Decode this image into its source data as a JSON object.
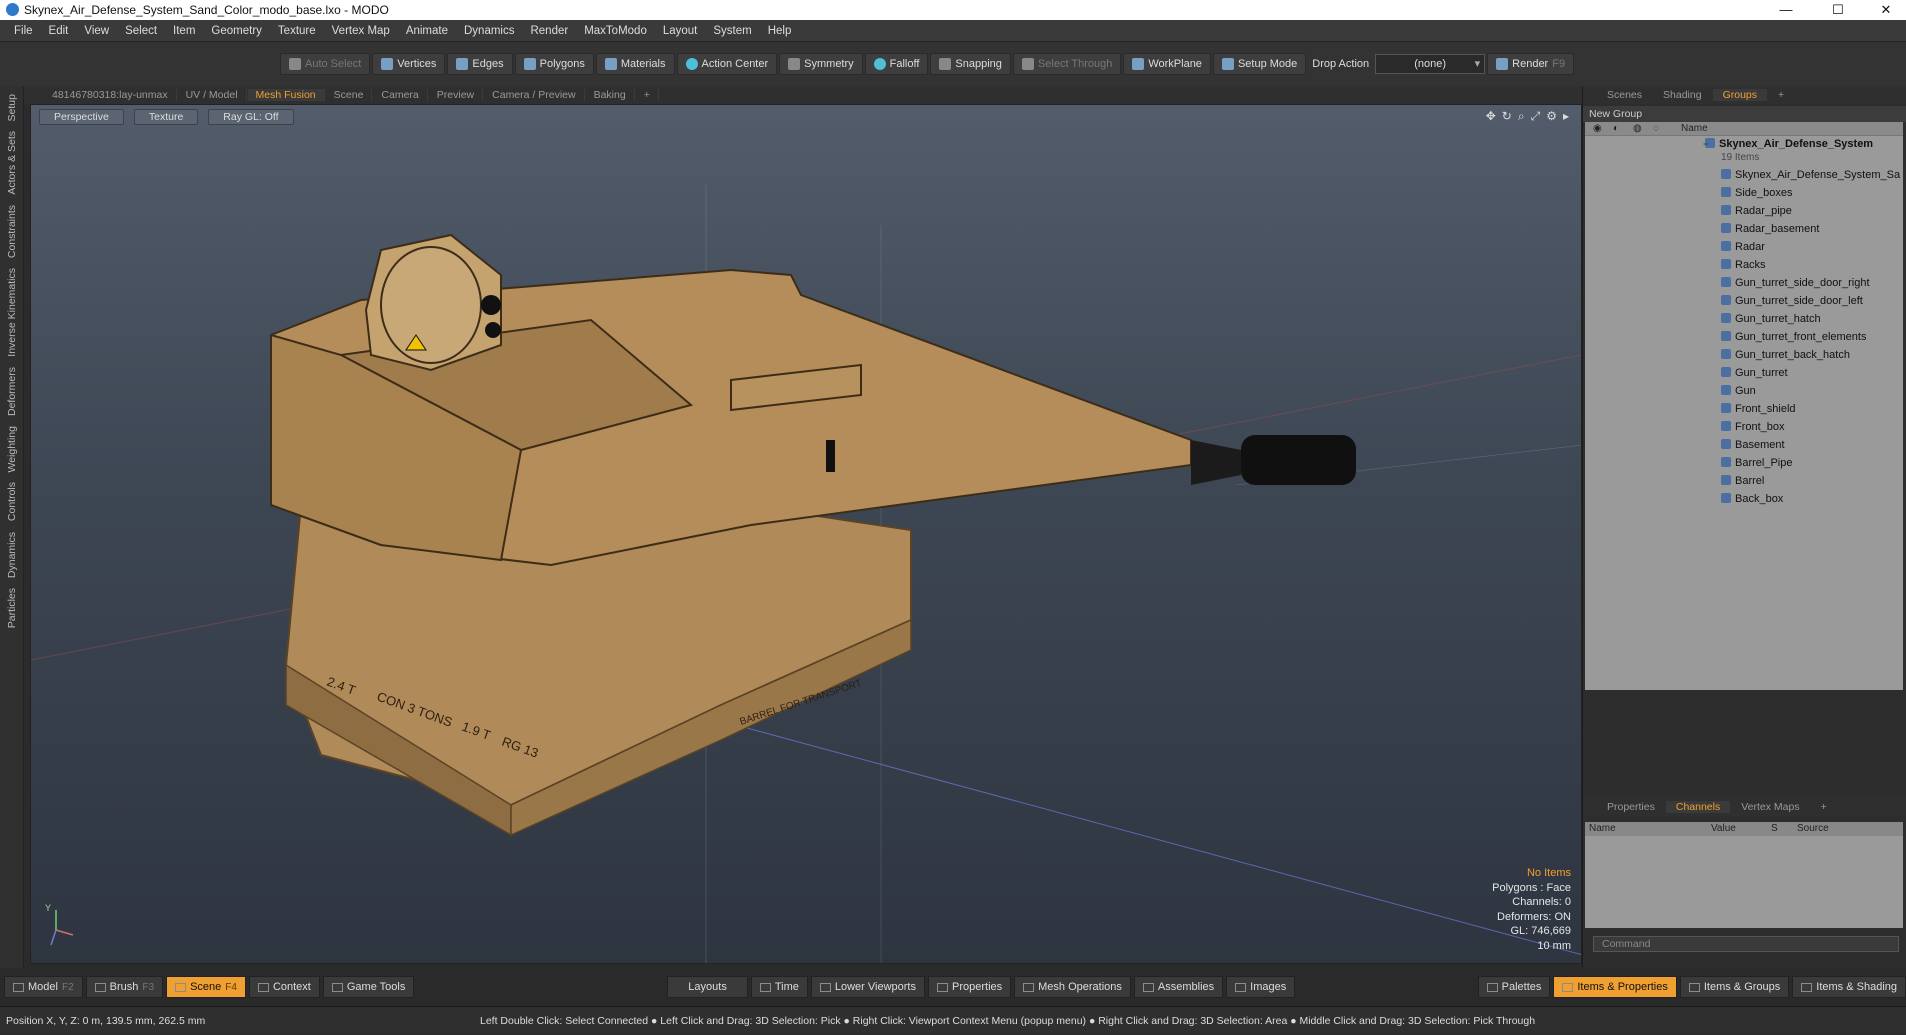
{
  "window": {
    "title": "Skynex_Air_Defense_System_Sand_Color_modo_base.lxo - MODO",
    "min": "—",
    "max": "☐",
    "close": "✕"
  },
  "menu": [
    "File",
    "Edit",
    "View",
    "Select",
    "Item",
    "Geometry",
    "Texture",
    "Vertex Map",
    "Animate",
    "Dynamics",
    "Render",
    "MaxToModo",
    "Layout",
    "System",
    "Help"
  ],
  "toolbar": {
    "auto_select": "Auto Select",
    "vertices": "Vertices",
    "edges": "Edges",
    "polygons": "Polygons",
    "materials": "Materials",
    "action_center": "Action Center",
    "symmetry": "Symmetry",
    "falloff": "Falloff",
    "snapping": "Snapping",
    "select_through": "Select Through",
    "workplane": "WorkPlane",
    "setup_mode": "Setup Mode",
    "drop_action_label": "Drop Action",
    "drop_action_value": "(none)",
    "render": "Render",
    "render_key": "F9"
  },
  "left_tabs": [
    "Setup",
    "Actors & Sets",
    "Constraints",
    "Inverse Kinematics",
    "Deformers",
    "Weighting",
    "Controls",
    "Dynamics",
    "Particles"
  ],
  "viewport_tabs": [
    "48146780318:lay-unmax",
    "UV / Model",
    "Mesh Fusion",
    "Scene",
    "Camera",
    "Preview",
    "Camera / Preview",
    "Baking",
    "+"
  ],
  "viewport_active_tab": "Mesh Fusion",
  "viewport": {
    "perspective": "Perspective",
    "texture": "Texture",
    "raygl": "Ray GL: Off",
    "axis_y": "Y",
    "decal_text": "BARREL FOR TRANSPORT",
    "crate_texts": [
      "2.4 T",
      "CON 3 TONS",
      "1.9 T",
      "RG 13"
    ],
    "stats": {
      "no_items": "No Items",
      "polygons": "Polygons : Face",
      "channels": "Channels: 0",
      "deformers": "Deformers: ON",
      "gl": "GL: 746,669",
      "scale": "10 mm"
    }
  },
  "right_tabs": [
    "Scenes",
    "Shading",
    "Groups",
    "+"
  ],
  "right_active_tab": "Groups",
  "groups": {
    "new_group": "New Group",
    "name_header": "Name",
    "root": "Skynex_Air_Defense_System",
    "root_count": "19 Items",
    "items": [
      "Skynex_Air_Defense_System_Sa ...",
      "Side_boxes",
      "Radar_pipe",
      "Radar_basement",
      "Radar",
      "Racks",
      "Gun_turret_side_door_right",
      "Gun_turret_side_door_left",
      "Gun_turret_hatch",
      "Gun_turret_front_elements",
      "Gun_turret_back_hatch",
      "Gun_turret",
      "Gun",
      "Front_shield",
      "Front_box",
      "Basement",
      "Barrel_Pipe",
      "Barrel",
      "Back_box"
    ]
  },
  "lower_tabs": [
    "Properties",
    "Channels",
    "Vertex Maps",
    "+"
  ],
  "lower_active_tab": "Channels",
  "channels": {
    "name": "Name",
    "value": "Value",
    "s": "S",
    "source": "Source"
  },
  "command_placeholder": "Command",
  "bottom": {
    "model": "Model",
    "model_key": "F2",
    "brush": "Brush",
    "brush_key": "F3",
    "scene": "Scene",
    "scene_key": "F4",
    "context": "Context",
    "game_tools": "Game Tools",
    "layouts": "Layouts",
    "time": "Time",
    "lower_viewports": "Lower Viewports",
    "properties": "Properties",
    "mesh_operations": "Mesh Operations",
    "assemblies": "Assemblies",
    "images": "Images",
    "palettes": "Palettes",
    "items_properties": "Items & Properties",
    "items_groups": "Items & Groups",
    "items_shading": "Items & Shading"
  },
  "status": {
    "position": "Position X, Y, Z:   0 m, 139.5 mm, 262.5 mm",
    "hint": "Left Double Click: Select Connected ● Left Click and Drag: 3D Selection: Pick ● Right Click: Viewport Context Menu (popup menu) ● Right Click and Drag: 3D Selection: Area ● Middle Click and Drag: 3D Selection: Pick Through"
  }
}
